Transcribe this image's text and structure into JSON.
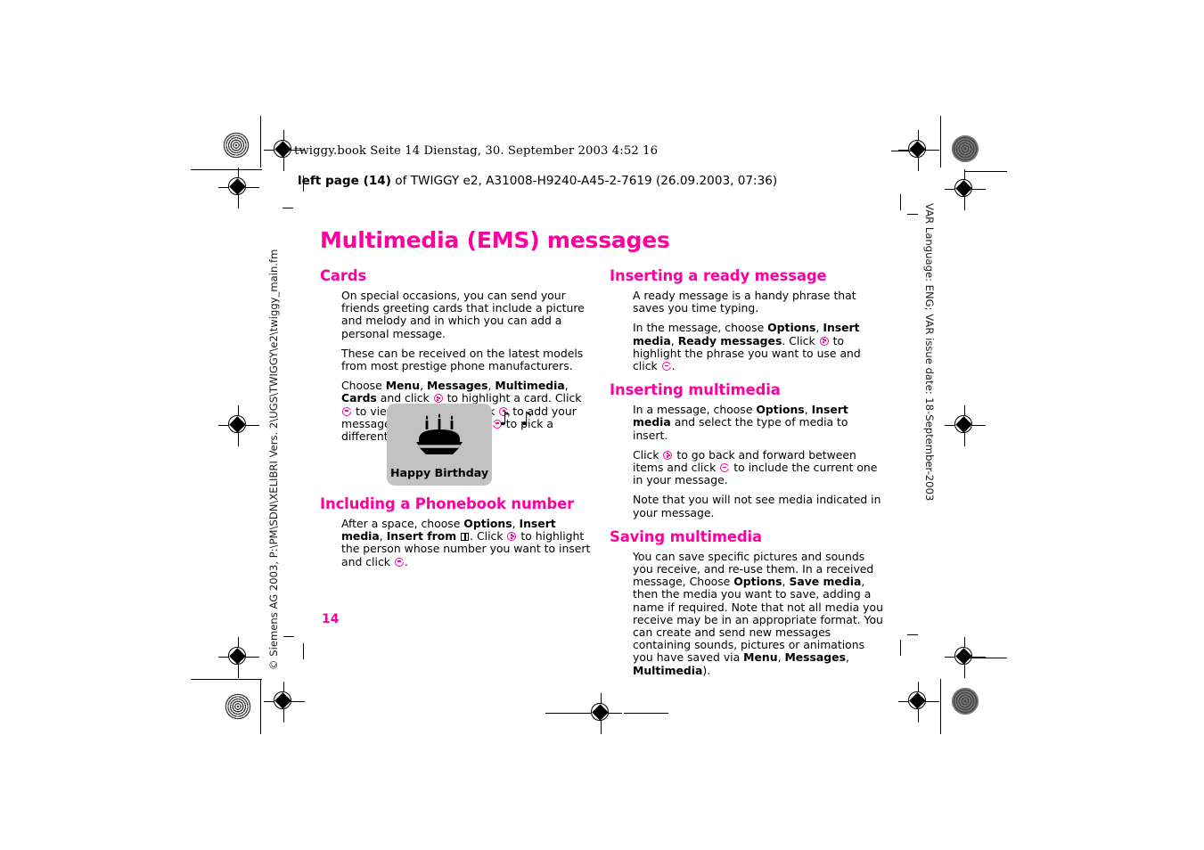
{
  "meta": {
    "accent_color": "#ff00a0",
    "card_bg": "#c2c2c2"
  },
  "header": {
    "filestamp": "twiggy.book  Seite 14  Dienstag, 30. September 2003  4:52 16",
    "page_info_bold": "left page (14)",
    "page_info_rest": " of TWIGGY e2, A31008-H9240-A45-2-7619 (26.09.2003, 07:36)"
  },
  "side": {
    "left_vertical": "© Siemens AG 2003, P:\\PM\\SDN\\XELIBRI Vers. 2\\UGS\\TWIGGY\\e2\\twiggy_main.fm",
    "right_vertical": "VAR Language: ENG; VAR issue date: 18-September-2003"
  },
  "chapter_title": "Multimedia (EMS) messages",
  "page_number": "14",
  "left_column": {
    "cards": {
      "heading": "Cards",
      "p1": "On special occasions, you can send your friends greeting cards that include a picture and melody and in which you can add a personal message.",
      "p2": "These can be received on the latest models from most prestige phone manufacturers.",
      "p3_parts": {
        "t1": "Choose ",
        "b1": "Menu",
        "t2": ", ",
        "b2": "Messages",
        "t3": ", ",
        "b3": "Multimedia",
        "t4": ", ",
        "b4": "Cards",
        "t5": " and click ",
        "t6": " to highlight a card. Click ",
        "t7": " to view it and either click ",
        "t8": " to add your message and send or click ",
        "t9": " to pick a different one."
      }
    },
    "figure": {
      "caption": "Happy Birthday",
      "icon_name": "birthday-cake-icon",
      "notes": "♪ ♪"
    },
    "phonebook": {
      "heading": "Including a Phonebook number",
      "p1_parts": {
        "t1": "After a space, choose ",
        "b1": "Options",
        "t2": ", ",
        "b2": "Insert media",
        "t3": ", ",
        "b3": "Insert from",
        "t4": ". Click ",
        "t5": " to highlight the person whose number you want to insert and click ",
        "t6": "."
      }
    }
  },
  "right_column": {
    "ready_message": {
      "heading": "Inserting a ready message",
      "p1": "A ready message is a handy phrase that saves you time typing.",
      "p2_parts": {
        "t1": "In the message, choose ",
        "b1": "Options",
        "t2": ", ",
        "b2": "Insert media",
        "t3": ", ",
        "b3": "Ready messages",
        "t4": ". Click ",
        "t5": " to highlight the phrase you want to use and click ",
        "t6": "."
      }
    },
    "inserting_multimedia": {
      "heading": "Inserting multimedia",
      "p1_parts": {
        "t1": "In a message, choose ",
        "b1": "Options",
        "t2": ", ",
        "b2": "Insert media",
        "t3": " and select the type of media to insert."
      },
      "p2_parts": {
        "t1": "Click ",
        "t2": " to go back and forward between items and click ",
        "t3": " to include the current one in your message."
      },
      "p3": "Note that you will not see media indicated in your message."
    },
    "saving_multimedia": {
      "heading": "Saving multimedia",
      "p1_parts": {
        "t1": "You can save specific pictures and sounds you receive, and re-use them. In a received message, Choose ",
        "b1": "Options",
        "t2": ", ",
        "b2": "Save media",
        "t3": ", then the media you want to save, adding a name if required. Note that not all media you receive may be in an appropriate format. You can create and send new messages containing sounds, pictures or animations you have saved via ",
        "b3": "Menu",
        "t4": ", ",
        "b4": "Messages",
        "t5": ", ",
        "b5": "Multimedia",
        "t6": ")."
      }
    }
  }
}
